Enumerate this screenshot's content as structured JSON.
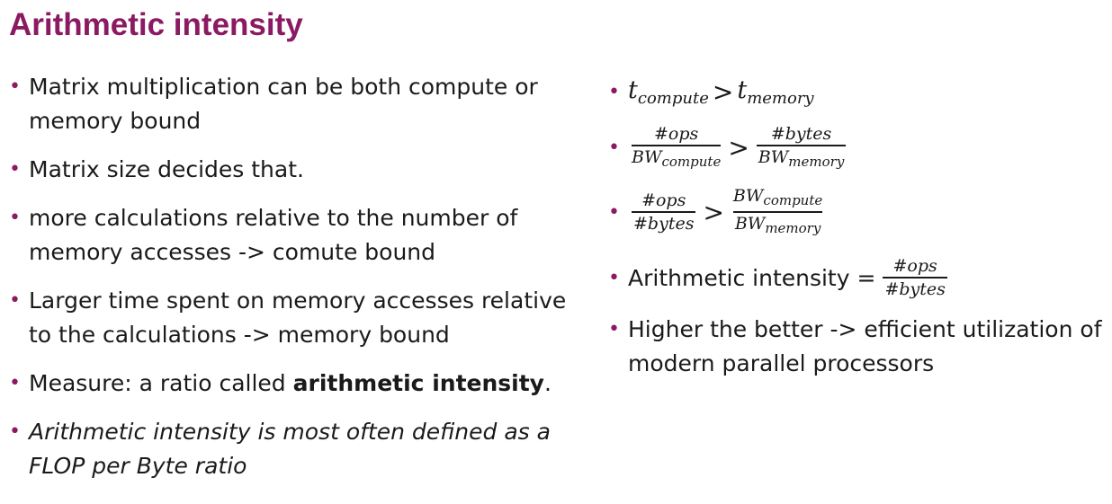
{
  "slide": {
    "title": "Arithmetic intensity",
    "bullet_color": "#8b1a62",
    "title_color": "#8b1a62"
  },
  "left_bullets": {
    "b1": "Matrix multiplication can be both compute or memory bound",
    "b2": "Matrix size decides that.",
    "b3": "more calculations relative to the number of memory accesses -> comute bound",
    "b4": "Larger time spent on memory accesses relative to the calculations -> memory bound",
    "b5_prefix": "Measure: a ratio called ",
    "b5_bold": "arithmetic intensity",
    "b5_suffix": ".",
    "b6": "Arithmetic intensity is most often defined as a FLOP per Byte ratio"
  },
  "right_bullets": {
    "eq1": {
      "t": "t",
      "sub_compute": "compute",
      "gt": ">",
      "sub_memory": "memory"
    },
    "eq2": {
      "num_left": "#ops",
      "den_left_base": "BW",
      "den_left_sub": "compute",
      "gt": ">",
      "num_right": "#bytes",
      "den_right_base": "BW",
      "den_right_sub": "memory"
    },
    "eq3": {
      "num_left": "#ops",
      "den_left": "#bytes",
      "gt": ">",
      "num_right_base": "BW",
      "num_right_sub": "compute",
      "den_right_base": "BW",
      "den_right_sub": "memory"
    },
    "eq4": {
      "label": "Arithmetic intensity =",
      "num": "#ops",
      "den": "#bytes"
    },
    "b5": "Higher the better -> efficient utilization of modern parallel processors"
  }
}
